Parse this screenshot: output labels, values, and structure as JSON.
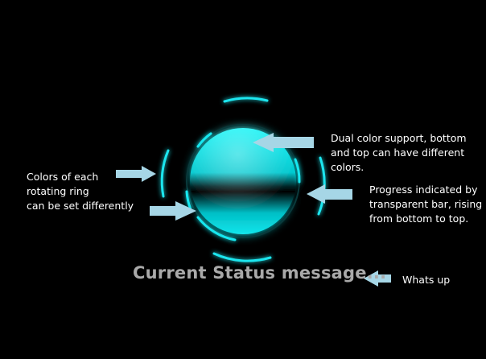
{
  "status": {
    "message": "Current Status message..."
  },
  "annotations": {
    "ring_colors": "Colors of each\nrotating ring\ncan be set differently",
    "dual_color": "Dual color support, bottom\nand top can have different\ncolors.",
    "progress": "Progress indicated by\ntransparent bar, rising\nfrom bottom to top.",
    "whats_up": "Whats up"
  },
  "colors": {
    "background": "#000000",
    "accent": "#00e5f0",
    "orb_top": "#10ffff",
    "orb_band": "#000000",
    "arrow": "#a4d4e4",
    "status_text": "#a9a9a9",
    "annotation_text": "#ffffff"
  }
}
